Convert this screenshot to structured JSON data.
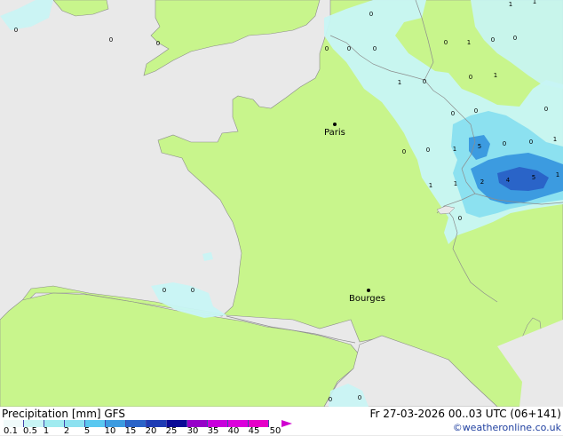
{
  "map": {
    "colors": {
      "sea": "#e9e9e9",
      "land": "#c8f58c",
      "precip_light": "#c8f5f5",
      "precip_medium": "#8ce1f0",
      "precip_heavy": "#3c9be0",
      "border": "#8c8c8c"
    },
    "cities": [
      {
        "name": "Paris"
      },
      {
        "name": "Bourges"
      }
    ],
    "values": [
      {
        "text": "0"
      },
      {
        "text": "0"
      },
      {
        "text": "0"
      },
      {
        "text": "0"
      },
      {
        "text": "0"
      },
      {
        "text": "0"
      },
      {
        "text": "0"
      },
      {
        "text": "1"
      },
      {
        "text": "0"
      },
      {
        "text": "0"
      },
      {
        "text": "1"
      },
      {
        "text": "1"
      },
      {
        "text": "0"
      },
      {
        "text": "1"
      },
      {
        "text": "0"
      },
      {
        "text": "0"
      },
      {
        "text": "1"
      },
      {
        "text": "1"
      },
      {
        "text": "5"
      },
      {
        "text": "0"
      },
      {
        "text": "0"
      },
      {
        "text": "1"
      },
      {
        "text": "0"
      },
      {
        "text": "1"
      },
      {
        "text": "1"
      },
      {
        "text": "2"
      },
      {
        "text": "4"
      },
      {
        "text": "5"
      },
      {
        "text": "1"
      },
      {
        "text": "0"
      },
      {
        "text": "0"
      },
      {
        "text": "0"
      },
      {
        "text": "0"
      },
      {
        "text": "0"
      },
      {
        "text": "0"
      },
      {
        "text": "0"
      },
      {
        "text": "0"
      },
      {
        "text": "0"
      }
    ]
  },
  "footer": {
    "title": "Precipitation [mm] GFS",
    "datetime": "Fr 27-03-2026 00..03 UTC (06+141)",
    "credit": "©weatheronline.co.uk",
    "scale_labels": [
      "0.1",
      "0.5",
      "1",
      "2",
      "5",
      "10",
      "15",
      "20",
      "25",
      "30",
      "35",
      "40",
      "45",
      "50"
    ],
    "scale_colors": [
      "#f0fafa",
      "#c8f5f5",
      "#a0ebf0",
      "#8ce1f0",
      "#5ac8f0",
      "#3c9be0",
      "#2a64c8",
      "#1e3cb4",
      "#0a0a96",
      "#9600c8",
      "#c800dc",
      "#dc00dc",
      "#e600c8"
    ]
  }
}
